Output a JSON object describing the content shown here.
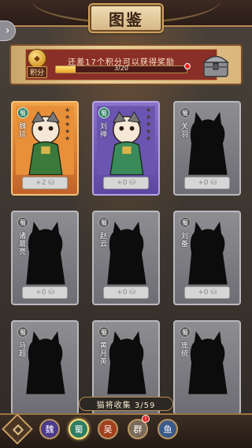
{
  "header": {
    "title": "图鉴",
    "back_icon": "chevron-right-icon"
  },
  "reward": {
    "message": "还差17个积分可以获得奖励",
    "points_label": "积分",
    "progress_text": "3/20",
    "progress_current": 3,
    "progress_total": 20
  },
  "cards": [
    {
      "faction": "蜀",
      "name": "魏延",
      "style": "orange",
      "shard": "+2",
      "unlocked": true
    },
    {
      "faction": "蜀",
      "name": "刘禅",
      "style": "purple",
      "shard": "+0",
      "unlocked": true
    },
    {
      "faction": "蜀",
      "name": "关羽",
      "style": "gray",
      "shard": "+0",
      "unlocked": false
    },
    {
      "faction": "蜀",
      "name": "诸葛亮",
      "style": "gray",
      "shard": "+0",
      "unlocked": false
    },
    {
      "faction": "蜀",
      "name": "赵云",
      "style": "gray",
      "shard": "+0",
      "unlocked": false
    },
    {
      "faction": "蜀",
      "name": "刘备",
      "style": "gray",
      "shard": "+0",
      "unlocked": false
    },
    {
      "faction": "蜀",
      "name": "马超",
      "style": "gray",
      "shard": "",
      "unlocked": false
    },
    {
      "faction": "蜀",
      "name": "黄月英",
      "style": "gray",
      "shard": "",
      "unlocked": false
    },
    {
      "faction": "蜀",
      "name": "庞统",
      "style": "gray",
      "shard": "",
      "unlocked": false
    }
  ],
  "collection": {
    "text": "猫将收集 3/59"
  },
  "nav": {
    "factions": [
      {
        "label": "魏",
        "color": "#4a3a8a",
        "active": false
      },
      {
        "label": "蜀",
        "color": "#2e7d62",
        "active": true
      },
      {
        "label": "吴",
        "color": "#a0401e",
        "active": false
      },
      {
        "label": "群",
        "color": "#7a6a5a",
        "active": false
      },
      {
        "label": "鱼",
        "color": "#3a5a8a",
        "active": false
      }
    ],
    "badge": "!"
  }
}
